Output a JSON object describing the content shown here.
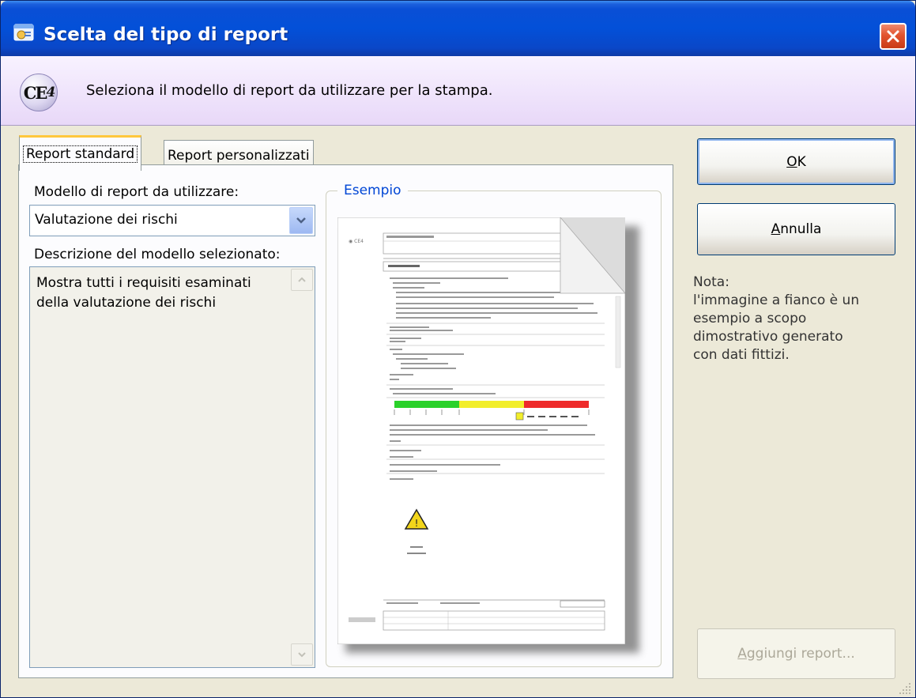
{
  "window": {
    "title": "Scelta del tipo di report"
  },
  "header": {
    "logo_text": "CE",
    "logo_sub": "4",
    "instruction": "Seleziona il modello di report da utilizzare per la stampa."
  },
  "tabs": [
    {
      "label": "Report standard",
      "active": true
    },
    {
      "label": "Report personalizzati",
      "active": false
    }
  ],
  "form": {
    "model_label": "Modello di report da utilizzare:",
    "model_selected": "Valutazione dei rischi",
    "description_label": "Descrizione del modello selezionato:",
    "description_lines": [
      "Mostra tutti i requisiti esaminati",
      "della valutazione dei rischi"
    ]
  },
  "example": {
    "caption": "Esempio"
  },
  "buttons": {
    "ok": {
      "mnemonic": "O",
      "rest": "K"
    },
    "cancel": {
      "mnemonic": "A",
      "rest": "nnulla"
    },
    "add_report": {
      "mnemonic": "A",
      "rest": "ggiungi report..."
    }
  },
  "note": {
    "lines": [
      "Nota:",
      "l'immagine a fianco è un",
      "esempio a scopo",
      "dimostrativo generato",
      "con dati fittizi."
    ]
  },
  "colors": {
    "titlebar": "#0350d8",
    "header": "#e8d8f8",
    "tab_highlight": "#ffc83c",
    "caption": "#0046d5",
    "risk_green": "#2ad12a",
    "risk_yellow": "#f2ee2a",
    "risk_red": "#ee2a2a"
  }
}
